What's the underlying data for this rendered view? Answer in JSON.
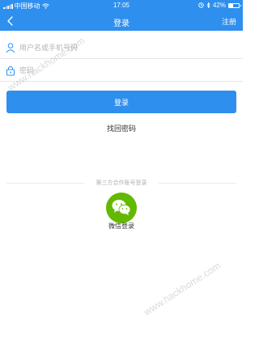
{
  "status_bar": {
    "carrier": "中国移动",
    "time": "17:05",
    "battery_percent": "42%",
    "battery_level": 0.42
  },
  "navbar": {
    "title": "登录",
    "register_label": "注册",
    "back_icon": "chevron-left-icon"
  },
  "form": {
    "username_placeholder": "用户名或手机号码",
    "password_placeholder": "密码",
    "username_icon": "user-icon",
    "password_icon": "lock-icon"
  },
  "login_button_label": "登录",
  "recover_password_label": "找回密码",
  "third_party": {
    "title": "第三方合作账号登录",
    "wechat_label": "微信登录",
    "wechat_icon": "wechat-icon",
    "wechat_color": "#62b900"
  },
  "watermark": {
    "text": "www.hackhome.com"
  },
  "colors": {
    "accent": "#2e8fef"
  }
}
